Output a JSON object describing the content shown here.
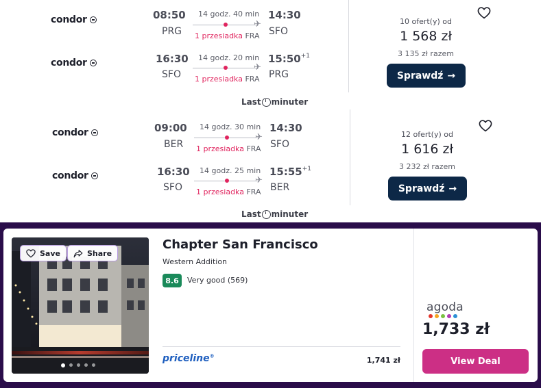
{
  "colors": {
    "accent_pink": "#e0245e",
    "button_navy": "#0d2847",
    "hotel_band": "#2a0d4a",
    "rating_green": "#1a8a5a",
    "view_deal_magenta": "#cc2f85",
    "priceline_blue": "#1f5fbf"
  },
  "flights": [
    {
      "legs": [
        {
          "airline": "condor",
          "depart_time": "08:50",
          "depart_code": "PRG",
          "duration": "14 godz. 40 min",
          "stops": "1 przesiadka",
          "hub": "FRA",
          "arrive_time": "14:30",
          "arrive_code": "SFO",
          "next_day": ""
        },
        {
          "airline": "condor",
          "depart_time": "16:30",
          "depart_code": "SFO",
          "duration": "14 godz. 20 min",
          "stops": "1 przesiadka",
          "hub": "FRA",
          "arrive_time": "15:50",
          "arrive_code": "PRG",
          "next_day": "+1"
        }
      ],
      "offers": "10 ofert(y) od",
      "price": "1 568 zł",
      "total": "3 135 zł razem",
      "button": "Sprawdź",
      "provider_a": "Last",
      "provider_b": "minuter"
    },
    {
      "legs": [
        {
          "airline": "condor",
          "depart_time": "09:00",
          "depart_code": "BER",
          "duration": "14 godz. 30 min",
          "stops": "1 przesiadka",
          "hub": "FRA",
          "arrive_time": "14:30",
          "arrive_code": "SFO",
          "next_day": ""
        },
        {
          "airline": "condor",
          "depart_time": "16:30",
          "depart_code": "SFO",
          "duration": "14 godz. 25 min",
          "stops": "1 przesiadka",
          "hub": "FRA",
          "arrive_time": "15:55",
          "arrive_code": "BER",
          "next_day": "+1"
        }
      ],
      "offers": "12 ofert(y) od",
      "price": "1 616 zł",
      "total": "3 232 zł razem",
      "button": "Sprawdź",
      "provider_a": "Last",
      "provider_b": "minuter"
    }
  ],
  "hotel": {
    "save_label": "Save",
    "share_label": "Share",
    "name": "Chapter San Francisco",
    "area": "Western Addition",
    "rating_score": "8.6",
    "rating_text": "Very good (569)",
    "photo_index": 1,
    "photo_count": 5,
    "alt_provider": "priceline",
    "alt_provider_mark": "®",
    "alt_price": "1,741 zł",
    "main_provider": "agoda",
    "main_price": "1,733 zł",
    "view_deal": "View Deal"
  }
}
